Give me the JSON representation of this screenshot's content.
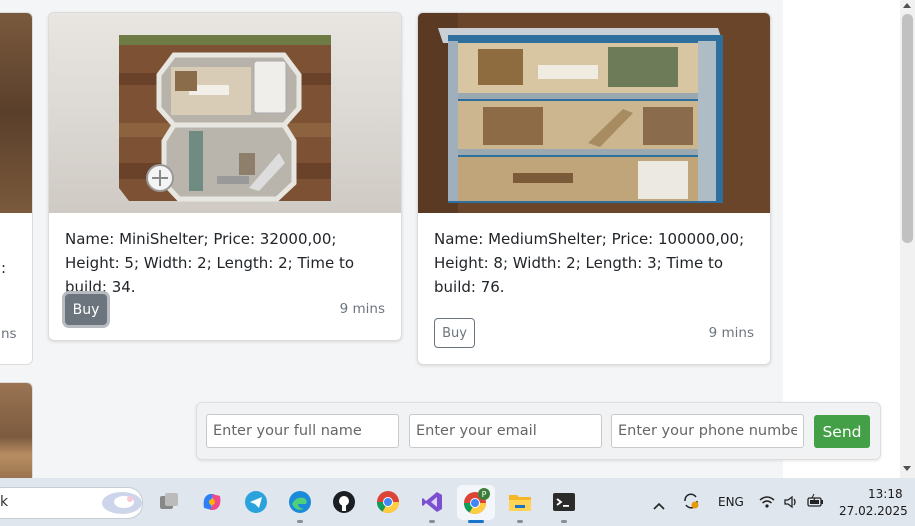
{
  "cards": [
    {
      "description": "Name: MiniShelter; Price: 32000,00; Height: 5; Width: 2; Length: 2; Time to build: 34.",
      "buy_label": "Buy",
      "time": "9 mins"
    },
    {
      "description": "Name: MediumShelter; Price: 100000,00; Height: 8; Width: 2; Length: 3; Time to build: 76.",
      "buy_label": "Buy",
      "time": "9 mins"
    }
  ],
  "partial_card": {
    "colon": ":",
    "time_fragment": "ns"
  },
  "order_form": {
    "name_placeholder": "Enter your full name",
    "email_placeholder": "Enter your email",
    "phone_placeholder": "Enter your phone number",
    "send_label": "Send"
  },
  "taskbar": {
    "search_chevron": "k",
    "apps": [
      "widgets-icon",
      "task-view-icon",
      "copilot-icon",
      "telegram-icon",
      "edge-icon",
      "github-icon",
      "chrome-icon",
      "visual-studio-icon",
      "chrome-profile-icon",
      "file-explorer-icon",
      "terminal-icon"
    ],
    "chrome_profile_badge": "P",
    "tray": {
      "language": "ENG",
      "time": "13:18",
      "date": "27.02.2025"
    }
  },
  "colors": {
    "send_button": "#43a047",
    "buy_active": "#6c757d",
    "page_bg": "#f4f5f7"
  }
}
